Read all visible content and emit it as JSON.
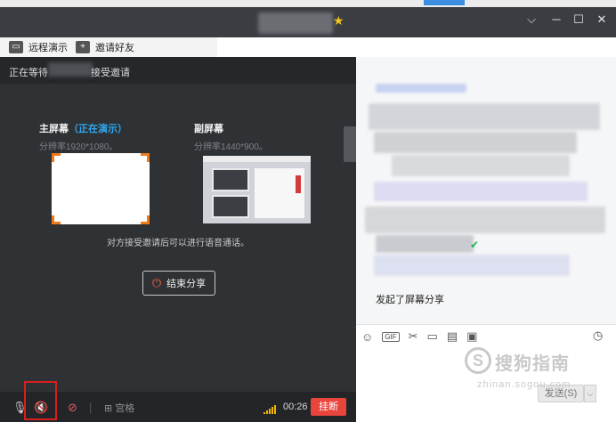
{
  "window": {
    "min_label": "─",
    "max_label": "☐",
    "close_label": "✕",
    "dropdown_label": "⌵",
    "star_label": "★"
  },
  "toolbar": {
    "remote_demo": "远程演示",
    "invite_friends": "邀请好友",
    "remote_icon": "monitor-icon",
    "invite_icon": "plus-icon"
  },
  "status": {
    "prefix": "正在等待",
    "suffix": "接受邀请"
  },
  "screens": {
    "main": {
      "title": "主屏幕",
      "badge": "（正在演示）",
      "resolution": "分辨率1920*1080。"
    },
    "sub": {
      "title": "副屏幕",
      "resolution": "分辨率1440*900。"
    }
  },
  "hint": "对方接受邀请后可以进行语音通话。",
  "end_share": {
    "label": "结束分享",
    "icon": "power-icon"
  },
  "call_bar": {
    "grid_label": "宫格",
    "timer": "00:26",
    "hangup": "挂断",
    "mic_icon": "mic-muted-icon",
    "speaker_icon": "speaker-muted-icon",
    "camera_icon": "camera-off-icon",
    "grid_icon": "grid-icon"
  },
  "chat": {
    "shared_message": "发起了屏幕分享",
    "tools": [
      "emoji-icon",
      "gif-icon",
      "scissors-icon",
      "folder-icon",
      "file-icon",
      "image-icon"
    ],
    "gif_label": "GIF",
    "send_label": "发送(S)",
    "send_dropdown": "⌵"
  },
  "watermark": {
    "logo": "S",
    "text": "搜狗指南",
    "url": "zhinan.sogou.com"
  },
  "colors": {
    "accent_blue": "#2fa8f0",
    "hangup_red": "#e8453c",
    "orange_corner": "#ef7a1a",
    "verified_green": "#1fb55a"
  }
}
